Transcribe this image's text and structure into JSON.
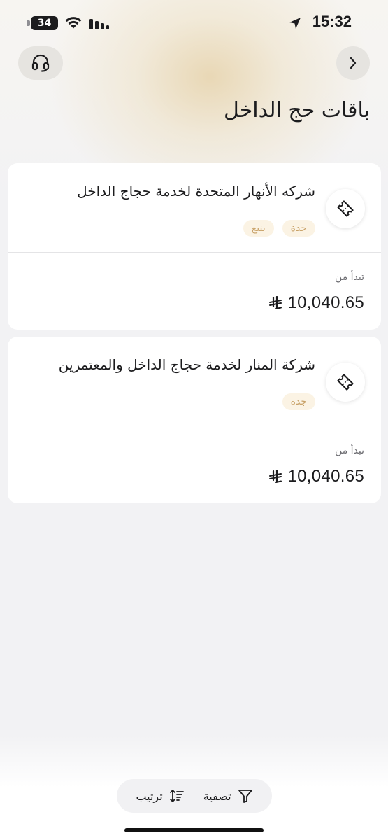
{
  "status_bar": {
    "time": "15:32",
    "battery_level": "34",
    "icons": [
      "location-arrow-icon",
      "wifi-icon",
      "signal-icon",
      "battery-icon"
    ]
  },
  "header": {
    "title": "باقات حج الداخل",
    "left_icon": "headset-icon",
    "right_icon": "chevron-right-icon"
  },
  "packages": [
    {
      "name": "شركه الأنهار المتحدة لخدمة حجاج الداخل",
      "tags": [
        "جدة",
        "ينبع"
      ],
      "from_label": "تبدأ من",
      "price": "10,040.65",
      "icon": "ticket-icon"
    },
    {
      "name": "شركة المنار لخدمة حجاج الداخل والمعتمرين",
      "tags": [
        "جدة"
      ],
      "from_label": "تبدأ من",
      "price": "10,040.65",
      "icon": "ticket-icon"
    }
  ],
  "currency_icon": "riyal-symbol-icon",
  "bottom_actions": {
    "filter_label": "تصفية",
    "sort_label": "ترتيب",
    "filter_icon": "filter-icon",
    "sort_icon": "sort-icon"
  },
  "colors": {
    "tag_bg": "#fbf3e4",
    "tag_text": "#c9a36a",
    "hero_accent": "#e8d6b2"
  }
}
